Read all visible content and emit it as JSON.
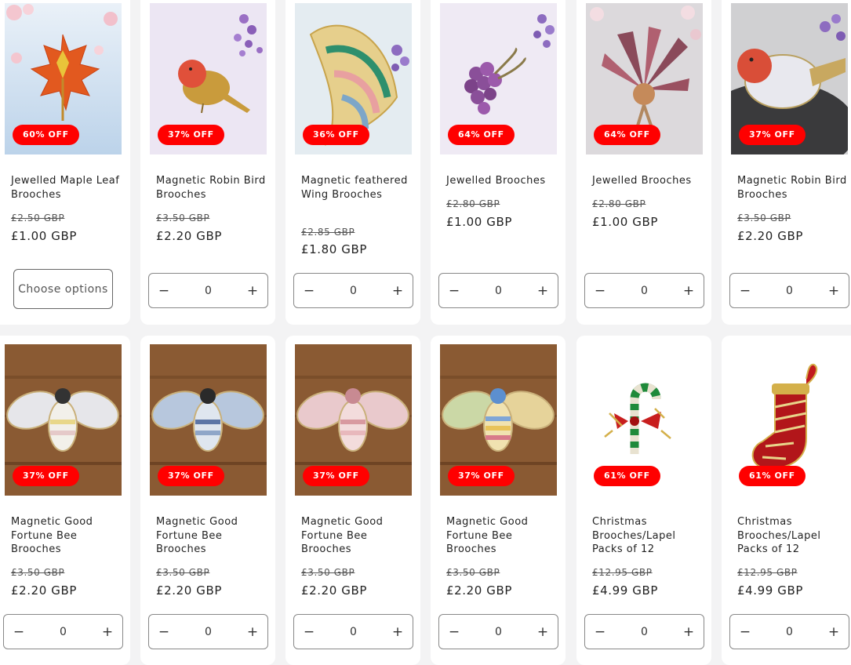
{
  "colors": {
    "badge": "#ff0000",
    "card": "#ffffff",
    "page": "#f3f3f4"
  },
  "qty_controls": {
    "minus": "−",
    "plus": "+"
  },
  "row1": [
    {
      "title": "Jewelled Maple Leaf Brooches",
      "old": "£2.50 GBP",
      "new": "£1.00 GBP",
      "badge": "60% OFF",
      "action": "Choose options",
      "image": "maple-leaf-brooch"
    },
    {
      "title": "Magnetic Robin Bird Brooches",
      "old": "£3.50 GBP",
      "new": "£2.20 GBP",
      "badge": "37% OFF",
      "qty": "0",
      "image": "robin-brooch"
    },
    {
      "title": "Magnetic feathered Wing Brooches",
      "old": "£2.85 GBP",
      "new": "£1.80 GBP",
      "badge": "36% OFF",
      "qty": "0",
      "image": "wing-brooch"
    },
    {
      "title": "Jewelled Brooches",
      "old": "£2.80 GBP",
      "new": "£1.00 GBP",
      "badge": "64% OFF",
      "qty": "0",
      "image": "purple-grape-brooch"
    },
    {
      "title": "Jewelled Brooches",
      "old": "£2.80 GBP",
      "new": "£1.00 GBP",
      "badge": "64% OFF",
      "qty": "0",
      "image": "pink-bouquet-brooch"
    },
    {
      "title": "Magnetic Robin Bird Brooches",
      "old": "£3.50 GBP",
      "new": "£2.20 GBP",
      "badge": "37% OFF",
      "qty": "0",
      "image": "robin-brooch-dark"
    }
  ],
  "row2": [
    {
      "title": "Magnetic Good Fortune Bee Brooches",
      "old": "£3.50 GBP",
      "new": "£2.20 GBP",
      "badge": "37% OFF",
      "qty": "0",
      "image": "bee-brooch-white"
    },
    {
      "title": "Magnetic Good Fortune Bee Brooches",
      "old": "£3.50 GBP",
      "new": "£2.20 GBP",
      "badge": "37% OFF",
      "qty": "0",
      "image": "bee-brooch-blue"
    },
    {
      "title": "Magnetic Good Fortune Bee Brooches",
      "old": "£3.50 GBP",
      "new": "£2.20 GBP",
      "badge": "37% OFF",
      "qty": "0",
      "image": "bee-brooch-pink"
    },
    {
      "title": "Magnetic Good Fortune Bee Brooches",
      "old": "£3.50 GBP",
      "new": "£2.20 GBP",
      "badge": "37% OFF",
      "qty": "0",
      "image": "bee-brooch-rainbow"
    },
    {
      "title": "Christmas Brooches/Lapel Packs of 12",
      "old": "£12.95 GBP",
      "new": "£4.99 GBP",
      "badge": "61% OFF",
      "qty": "0",
      "image": "candy-cane-brooch"
    },
    {
      "title": "Christmas Brooches/Lapel Packs of 12",
      "old": "£12.95 GBP",
      "new": "£4.99 GBP",
      "badge": "61% OFF",
      "qty": "0",
      "image": "stocking-brooch"
    }
  ]
}
